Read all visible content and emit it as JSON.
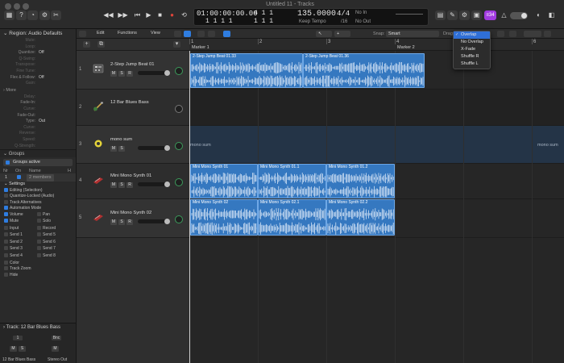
{
  "window": {
    "title": "Untitled 11 - Tracks"
  },
  "lcd": {
    "time": "01:00:00:00.00",
    "bars": "1 1 1 1",
    "position_top": "4 1 1",
    "position_bottom": "1 1 1",
    "tempo": "135.0000",
    "tempo_mode": "Keep Tempo",
    "signature": "4/4",
    "division": "/16",
    "in_label": "No In",
    "out_label": "No Out"
  },
  "counter_badge": "≡34",
  "inspector": {
    "region_header": "Region: Audio Defaults",
    "params": [
      {
        "label": "Mute:",
        "value": ""
      },
      {
        "label": "Loop:",
        "value": ""
      },
      {
        "label": "Quantize:",
        "value": "Off"
      },
      {
        "label": "Q-Swing:",
        "value": ""
      },
      {
        "label": "Transpose:",
        "value": ""
      },
      {
        "label": "Fine Tune:",
        "value": ""
      },
      {
        "label": "Flex & Follow:",
        "value": "Off"
      },
      {
        "label": "Gain:",
        "value": ""
      }
    ],
    "more_label": "More",
    "more_params": [
      {
        "label": "Delay:",
        "value": ""
      },
      {
        "label": "Fade-In:",
        "value": ""
      },
      {
        "label": "Curve:",
        "value": ""
      },
      {
        "label": "Fade-Out:",
        "value": ""
      },
      {
        "label": "Type:",
        "value": "Out"
      },
      {
        "label": "Curve:",
        "value": ""
      },
      {
        "label": "Reverse:",
        "value": ""
      },
      {
        "label": "Speed:",
        "value": ""
      },
      {
        "label": "Q-Strength:",
        "value": ""
      }
    ],
    "groups_header": "Groups",
    "groups_active": "Groups active",
    "group_cols": {
      "nr": "Nr",
      "on": "On",
      "name": "Name",
      "h": "H"
    },
    "group_row": {
      "nr": "1",
      "name": "2 members"
    },
    "settings_header": "Settings",
    "settings": [
      "Editing (Selection)",
      "Quantize-Locked (Audio)",
      "Track Alternatives",
      "Automation Mode"
    ],
    "checks_left": [
      "Volume",
      "Mute",
      "Input",
      "Send 1",
      "Send 2",
      "Send 3",
      "Send 4"
    ],
    "checks_right": [
      "Pan",
      "Solo",
      "Record",
      "Send 5",
      "Send 6",
      "Send 7",
      "Send 8"
    ],
    "checks_bottom": [
      "Color",
      "Track Zoom",
      "Hide"
    ],
    "track_header": "Track:  12 Bar Blues Bass",
    "strip_left_name": "12 Bar Blues Bass",
    "strip_right_name": "Stereo Out",
    "strip_right_value": "Bnc"
  },
  "toolbar": {
    "edit": "Edit",
    "functions": "Functions",
    "view": "View",
    "snap_label": "Snap:",
    "snap_value": "Smart",
    "drag_label": "Drag:"
  },
  "drag_menu": {
    "options": [
      "Overlap",
      "No Overlap",
      "X-Fade",
      "Shuffle R",
      "Shuffle L"
    ],
    "selected": "Overlap"
  },
  "ruler": {
    "bars": [
      "1",
      "2",
      "3",
      "4",
      "5",
      "6"
    ],
    "markers": [
      "Marker 1",
      "Marker 2"
    ]
  },
  "tracks": [
    {
      "num": "1",
      "name": "2-Step Jump Beat 01",
      "icon": "drum-machine-icon"
    },
    {
      "num": "2",
      "name": "12 Bar Blues Bass",
      "icon": "bass-guitar-icon"
    },
    {
      "num": "3",
      "name": "mono sum",
      "icon": "summing-stack-icon"
    },
    {
      "num": "4",
      "name": "Mini Mono Synth 01",
      "icon": "synth-keyboard-icon"
    },
    {
      "num": "5",
      "name": "Mini Mono Synth 02",
      "icon": "synth-keyboard-icon"
    }
  ],
  "msr": {
    "m": "M",
    "s": "S",
    "r": "R"
  },
  "regions": {
    "track1": [
      "2-Step Jump Beat 01.33",
      "2-Step Jump Beat 01.36"
    ],
    "track4": [
      "Mini Mono Synth 01",
      "Mini Mono Synth 01.1",
      "Mini Mono Synth 01.2"
    ],
    "track5": [
      "Mini Mono Synth 02",
      "Mini Mono Synth 02.1",
      "Mini Mono Synth 02.2"
    ],
    "sum_label": "mono sum"
  },
  "colors": {
    "region": "#3578c0",
    "accent": "#2f7de0",
    "selected_menu": "#2f6fd6",
    "record": "#e0443a",
    "badge": "#a23be0"
  }
}
